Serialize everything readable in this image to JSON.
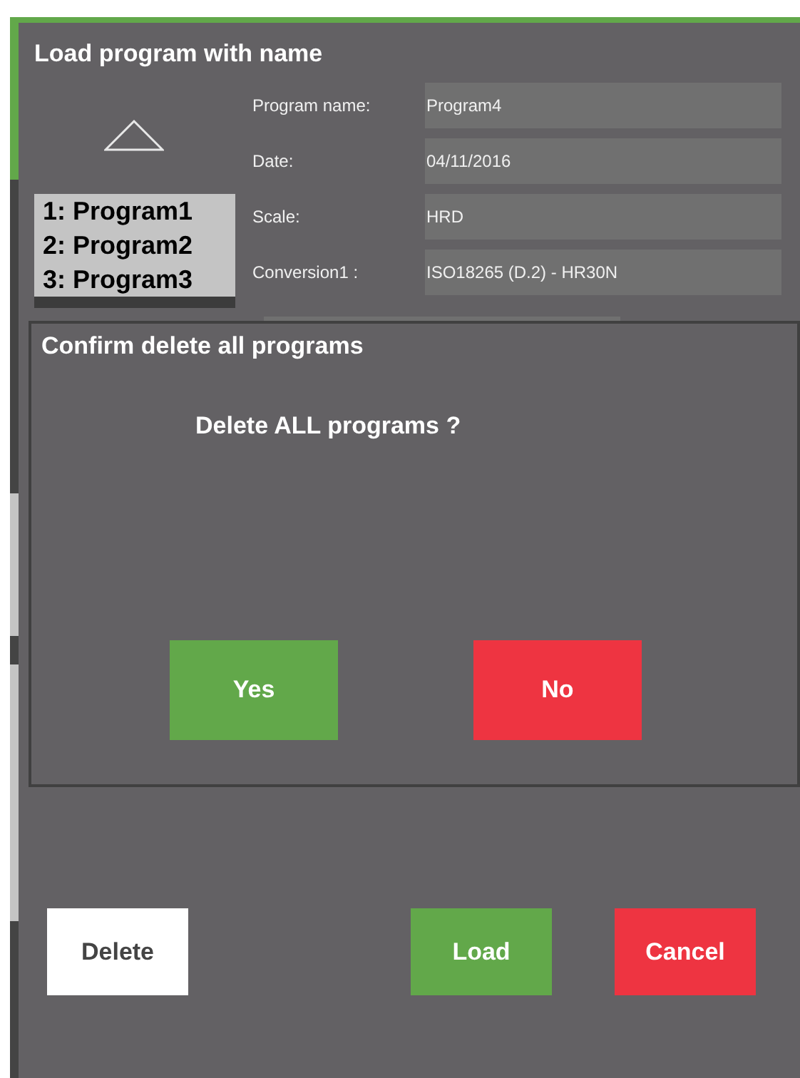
{
  "window": {
    "title": "Load program with name"
  },
  "program_list": [
    {
      "label": "1: Program1",
      "selected": false
    },
    {
      "label": "2: Program2",
      "selected": false
    },
    {
      "label": "3: Program3",
      "selected": false
    },
    {
      "selected": true
    }
  ],
  "fields": [
    {
      "label": "Program name:",
      "value": "Program4"
    },
    {
      "label": "Date:",
      "value": "04/11/2016"
    },
    {
      "label": "Scale:",
      "value": "HRD"
    },
    {
      "label": "Conversion1 :",
      "value": "ISO18265 (D.2) - HR30N"
    }
  ],
  "dialog": {
    "title": "Confirm delete all programs",
    "message": "Delete ALL programs ?",
    "buttons": [
      {
        "label": "Yes",
        "kind": "confirm"
      },
      {
        "label": "No",
        "kind": "cancel"
      }
    ]
  },
  "buttons": [
    {
      "label": "Delete",
      "kind": "neutral"
    },
    {
      "label": "Load",
      "kind": "confirm"
    },
    {
      "label": "Cancel",
      "kind": "cancel"
    }
  ]
}
